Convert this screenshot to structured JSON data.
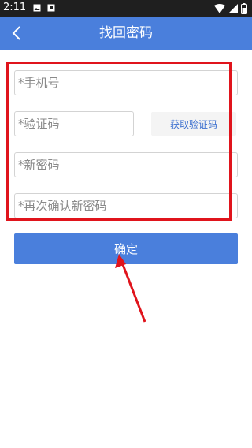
{
  "status_bar": {
    "time": "2:11",
    "left_icons": [
      "image-icon",
      "notification-icon"
    ],
    "right_icons": [
      "wifi-icon",
      "signal-icon",
      "battery-icon"
    ]
  },
  "header": {
    "title": "找回密码",
    "back_icon": "chevron-left-icon"
  },
  "form": {
    "phone_placeholder": "*手机号",
    "code_placeholder": "*验证码",
    "get_code_label": "获取验证码",
    "new_password_placeholder": "*新密码",
    "confirm_password_placeholder": "*再次确认新密码"
  },
  "confirm_label": "确定",
  "colors": {
    "accent": "#4a7fdc",
    "annotation": "#e0141c",
    "status_bar": "#1f1f1f"
  }
}
